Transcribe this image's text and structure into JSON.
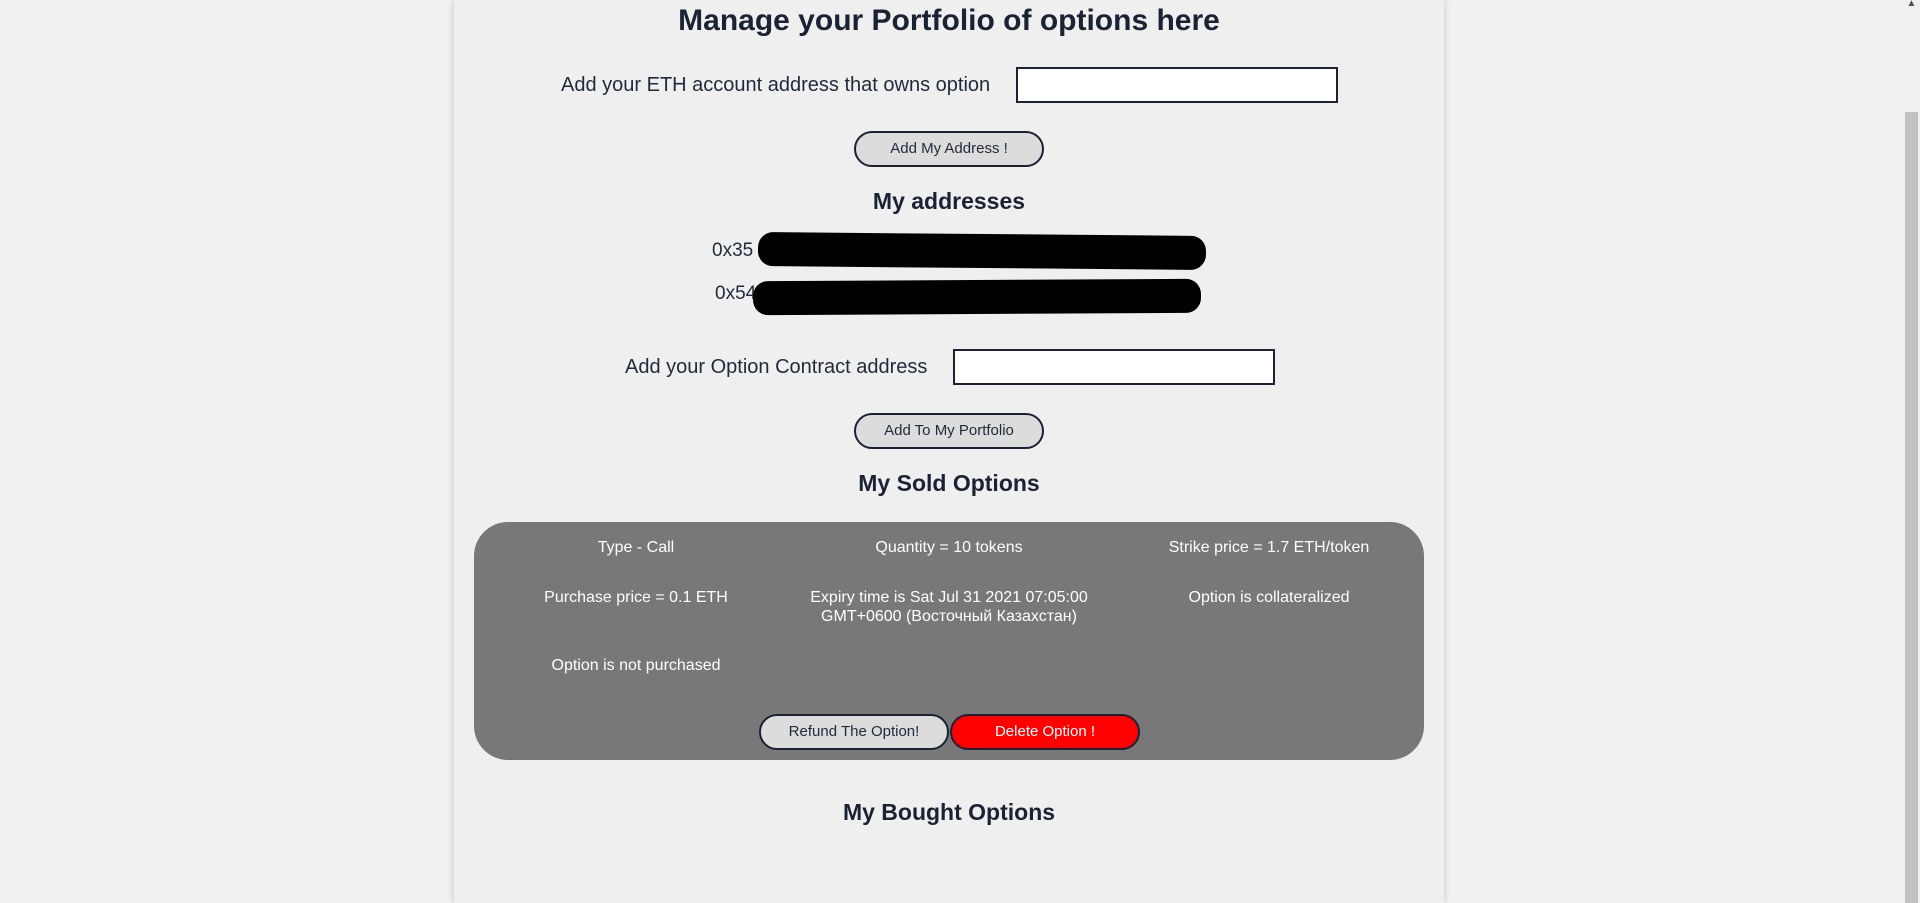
{
  "page": {
    "title": "Manage your Portfolio of options here"
  },
  "eth_account": {
    "label": "Add your ETH account address that owns option",
    "value": "",
    "button": "Add My Address !"
  },
  "addresses": {
    "title": "My addresses",
    "items": [
      "0x35",
      "0x54"
    ]
  },
  "option_contract": {
    "label": "Add your Option Contract address",
    "value": "",
    "button": "Add To My Portfolio"
  },
  "sold_options": {
    "title": "My Sold Options",
    "items": [
      {
        "type": "Type - Call",
        "quantity": "Quantity = 10 tokens",
        "strike": "Strike price = 1.7 ETH/token",
        "purchase_price": "Purchase price = 0.1 ETH",
        "expiry_line1": "Expiry time is Sat Jul 31 2021 07:05:00",
        "expiry_line2": "GMT+0600 (Восточный Казахстан)",
        "collateral": "Option is collateralized",
        "purchased": "Option is not purchased",
        "refund_button": "Refund The Option!",
        "delete_button": "Delete Option !"
      }
    ]
  },
  "bought_options": {
    "title": "My Bought Options"
  },
  "colors": {
    "background": "#f0f0f0",
    "card": "#787878",
    "delete": "#ff0000",
    "text": "#1a2233"
  }
}
